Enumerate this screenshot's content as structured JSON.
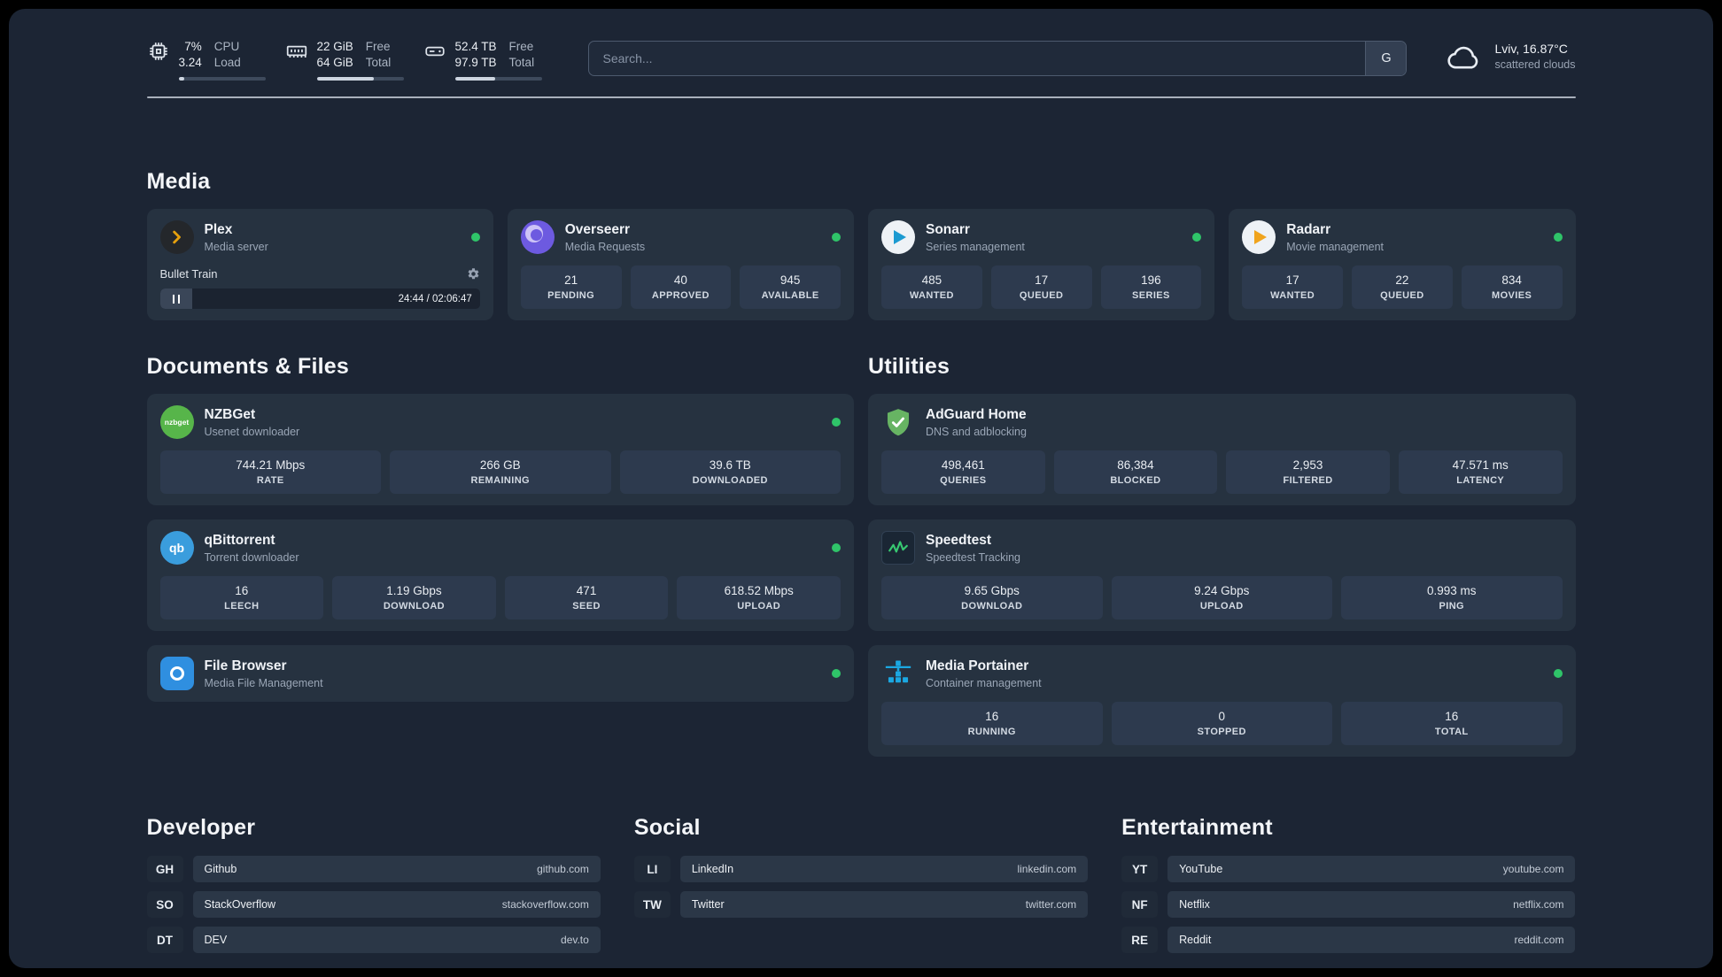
{
  "colors": {
    "status_online": "#2fc469",
    "plex_accent": "#e5a00d",
    "overseerr_purple": "#6d5ae0",
    "sonarr_accent": "#1b9ad1",
    "radarr_accent": "#f0a41d",
    "nzbget_green": "#57b54a",
    "qbittorrent_blue": "#3a9ddd",
    "filebrowser_blue": "#2f8fe0",
    "adguard_green": "#67b463",
    "speedtest_green": "#37c871",
    "portainer_blue": "#1ba8e2"
  },
  "topbar": {
    "cpu": {
      "col1": [
        "7%",
        "3.24"
      ],
      "col2": [
        "CPU",
        "Load"
      ],
      "percent": 7
    },
    "ram": {
      "col1": [
        "22 GiB",
        "64 GiB"
      ],
      "col2": [
        "Free",
        "Total"
      ],
      "percent": 66
    },
    "disk": {
      "col1": [
        "52.4 TB",
        "97.9 TB"
      ],
      "col2": [
        "Free",
        "Total"
      ],
      "percent": 46
    },
    "search": {
      "placeholder": "Search...",
      "engine_label": "G"
    },
    "weather": {
      "location": "Lviv, 16.87°C",
      "condition": "scattered clouds"
    }
  },
  "sections": {
    "media": "Media",
    "documents": "Documents & Files",
    "utilities": "Utilities",
    "developer": "Developer",
    "social": "Social",
    "entertainment": "Entertainment"
  },
  "apps": {
    "plex": {
      "name": "Plex",
      "subtitle": "Media server",
      "player": {
        "title": "Bullet Train",
        "time": "24:44 / 02:06:47",
        "progress_percent": 19
      }
    },
    "overseerr": {
      "name": "Overseerr",
      "subtitle": "Media Requests",
      "stats": [
        {
          "value": "21",
          "label": "PENDING"
        },
        {
          "value": "40",
          "label": "APPROVED"
        },
        {
          "value": "945",
          "label": "AVAILABLE"
        }
      ]
    },
    "sonarr": {
      "name": "Sonarr",
      "subtitle": "Series management",
      "stats": [
        {
          "value": "485",
          "label": "WANTED"
        },
        {
          "value": "17",
          "label": "QUEUED"
        },
        {
          "value": "196",
          "label": "SERIES"
        }
      ]
    },
    "radarr": {
      "name": "Radarr",
      "subtitle": "Movie management",
      "stats": [
        {
          "value": "17",
          "label": "WANTED"
        },
        {
          "value": "22",
          "label": "QUEUED"
        },
        {
          "value": "834",
          "label": "MOVIES"
        }
      ]
    },
    "nzbget": {
      "name": "NZBGet",
      "subtitle": "Usenet downloader",
      "icon_text": "nzbget",
      "stats": [
        {
          "value": "744.21 Mbps",
          "label": "RATE"
        },
        {
          "value": "266 GB",
          "label": "REMAINING"
        },
        {
          "value": "39.6 TB",
          "label": "DOWNLOADED"
        }
      ]
    },
    "qbittorrent": {
      "name": "qBittorrent",
      "subtitle": "Torrent downloader",
      "icon_text": "qb",
      "stats": [
        {
          "value": "16",
          "label": "LEECH"
        },
        {
          "value": "1.19 Gbps",
          "label": "DOWNLOAD"
        },
        {
          "value": "471",
          "label": "SEED"
        },
        {
          "value": "618.52 Mbps",
          "label": "UPLOAD"
        }
      ]
    },
    "filebrowser": {
      "name": "File Browser",
      "subtitle": "Media File Management"
    },
    "adguard": {
      "name": "AdGuard Home",
      "subtitle": "DNS and adblocking",
      "stats": [
        {
          "value": "498,461",
          "label": "QUERIES"
        },
        {
          "value": "86,384",
          "label": "BLOCKED"
        },
        {
          "value": "2,953",
          "label": "FILTERED"
        },
        {
          "value": "47.571 ms",
          "label": "LATENCY"
        }
      ]
    },
    "speedtest": {
      "name": "Speedtest",
      "subtitle": "Speedtest Tracking",
      "stats": [
        {
          "value": "9.65 Gbps",
          "label": "DOWNLOAD"
        },
        {
          "value": "9.24 Gbps",
          "label": "UPLOAD"
        },
        {
          "value": "0.993 ms",
          "label": "PING"
        }
      ]
    },
    "portainer": {
      "name": "Media Portainer",
      "subtitle": "Container management",
      "stats": [
        {
          "value": "16",
          "label": "RUNNING"
        },
        {
          "value": "0",
          "label": "STOPPED"
        },
        {
          "value": "16",
          "label": "TOTAL"
        }
      ]
    }
  },
  "bookmarks": {
    "developer": [
      {
        "abbr": "GH",
        "name": "Github",
        "url": "github.com"
      },
      {
        "abbr": "SO",
        "name": "StackOverflow",
        "url": "stackoverflow.com"
      },
      {
        "abbr": "DT",
        "name": "DEV",
        "url": "dev.to"
      }
    ],
    "social": [
      {
        "abbr": "LI",
        "name": "LinkedIn",
        "url": "linkedin.com"
      },
      {
        "abbr": "TW",
        "name": "Twitter",
        "url": "twitter.com"
      }
    ],
    "entertainment": [
      {
        "abbr": "YT",
        "name": "YouTube",
        "url": "youtube.com"
      },
      {
        "abbr": "NF",
        "name": "Netflix",
        "url": "netflix.com"
      },
      {
        "abbr": "RE",
        "name": "Reddit",
        "url": "reddit.com"
      }
    ]
  }
}
